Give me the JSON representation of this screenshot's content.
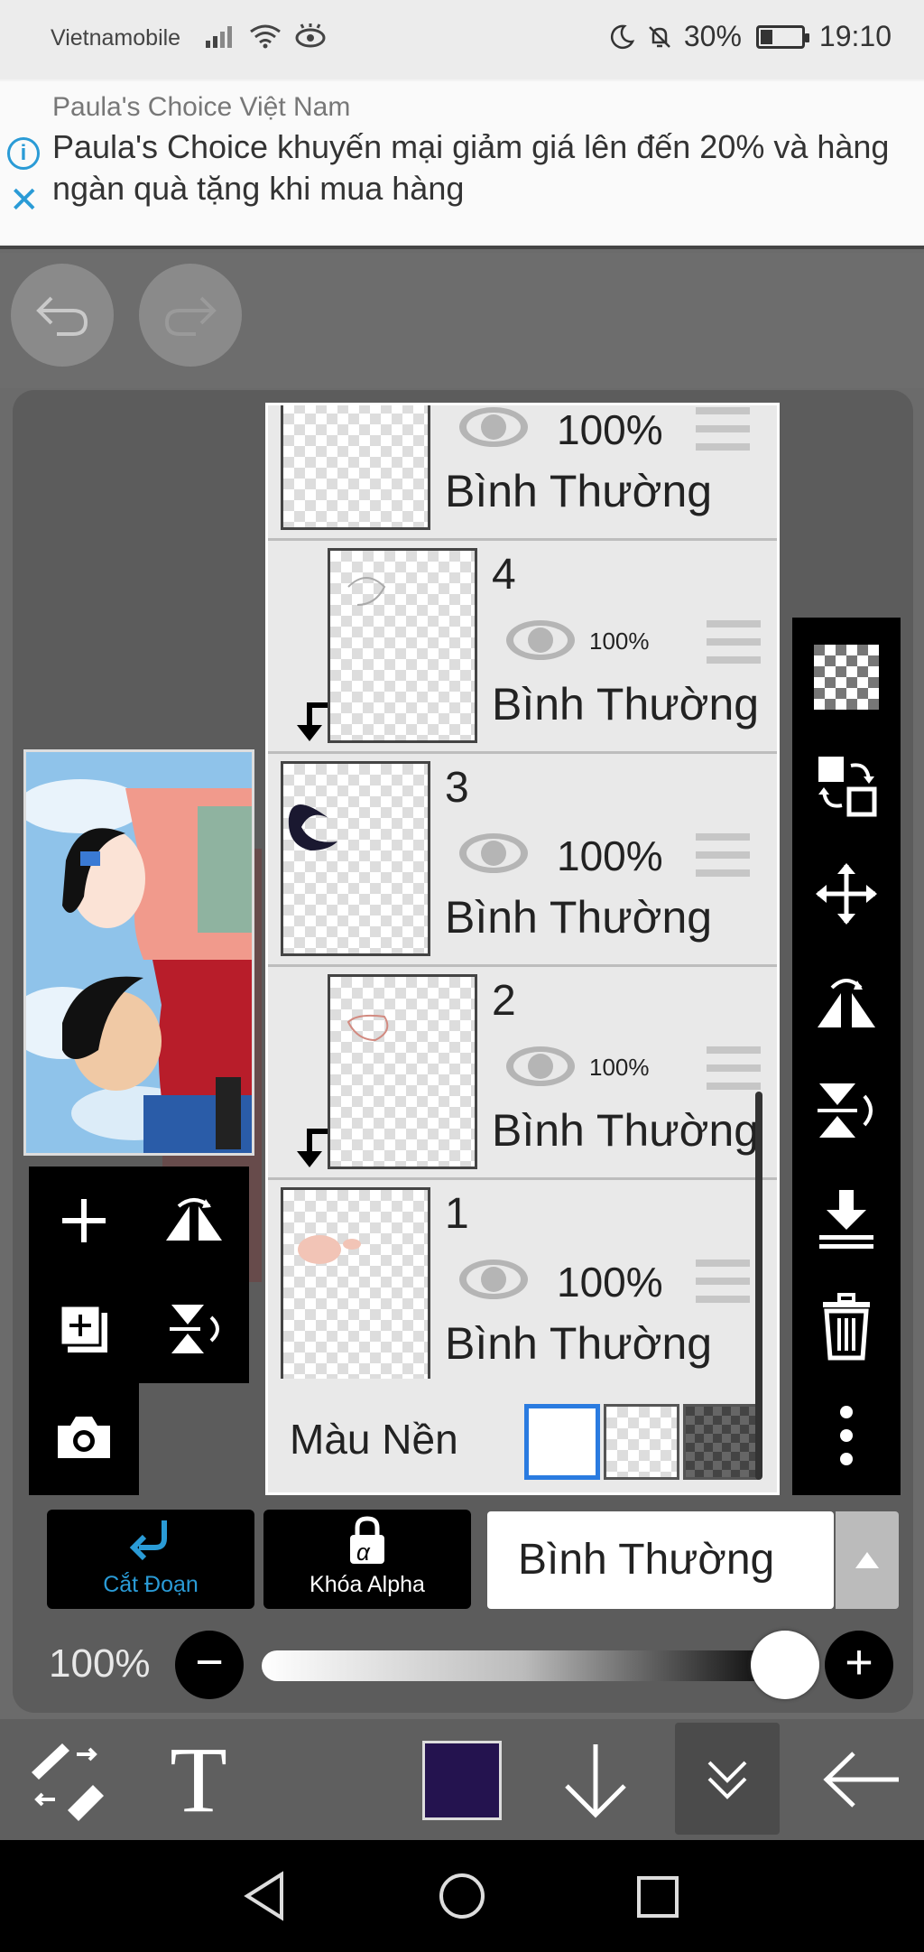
{
  "status_bar": {
    "carrier": "Vietnamobile",
    "battery": "30%",
    "battery_level": 0.3,
    "time": "19:10"
  },
  "ad": {
    "source": "Paula's Choice Việt Nam",
    "text": "Paula's Choice khuyến mại giảm giá lên đến 20% và hàng ngàn quà tặng khi mua hàng",
    "info_icon": "info-icon",
    "close_icon": "close-icon"
  },
  "history": {
    "undo_icon": "undo-icon",
    "redo_icon": "redo-icon"
  },
  "layers": [
    {
      "number": "",
      "opacity": "100%",
      "mode": "Bình Thường",
      "clipped": false
    },
    {
      "number": "4",
      "opacity": "100%",
      "mode": "Bình Thường",
      "clipped": true
    },
    {
      "number": "3",
      "opacity": "100%",
      "mode": "Bình Thường",
      "clipped": false
    },
    {
      "number": "2",
      "opacity": "100%",
      "mode": "Bình Thường",
      "clipped": true
    },
    {
      "number": "1",
      "opacity": "100%",
      "mode": "Bình Thường",
      "clipped": false
    }
  ],
  "background": {
    "label": "Màu Nền"
  },
  "right_tools": [
    "checker-icon",
    "swap-layer-icon",
    "move-icon",
    "flip-horizontal-icon",
    "flip-vertical-icon",
    "merge-down-icon",
    "trash-icon",
    "more-icon"
  ],
  "left_tools": [
    "add-layer-icon",
    "flip-icon",
    "add-folder-icon",
    "rotate-flip-icon",
    "camera-icon"
  ],
  "controls": {
    "clip_label": "Cắt Đoạn",
    "alpha_label": "Khóa Alpha",
    "alpha_symbol": "α",
    "blend_mode": "Bình Thường",
    "opacity": "100%",
    "opacity_value": 1.0,
    "minus": "−",
    "plus": "+"
  },
  "bottom_toolbar": {
    "text_tool": "T",
    "color": "#24134f"
  },
  "colors": {
    "accent": "#2a9bd6",
    "panel": "#5c5c5c"
  }
}
